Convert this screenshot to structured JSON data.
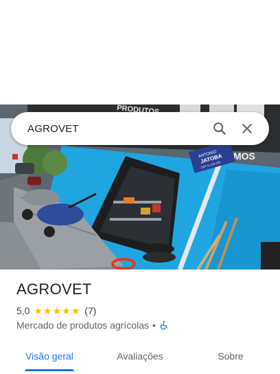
{
  "search": {
    "query": "AGROVET"
  },
  "place": {
    "name": "AGROVET",
    "rating": "5,0",
    "review_count": "(7)",
    "category": "Mercado de produtos agrícolas",
    "separator": "•",
    "accessibility_icon": "wheelchair-icon"
  },
  "tabs": [
    {
      "label": "Visão geral",
      "active": true
    },
    {
      "label": "Avaliações",
      "active": false
    },
    {
      "label": "Sobre",
      "active": false
    }
  ],
  "photo": {
    "store_sign": "PRODUTOS",
    "street_sign_line1": "ANTONIO",
    "street_sign_line2": "JATOBA",
    "street_sign_line3": "CEP 11-123-100",
    "sign_fragment": "MOS"
  },
  "colors": {
    "accent": "#1a73e8",
    "star": "#fbbc04",
    "wall": "#1fa6e0"
  }
}
